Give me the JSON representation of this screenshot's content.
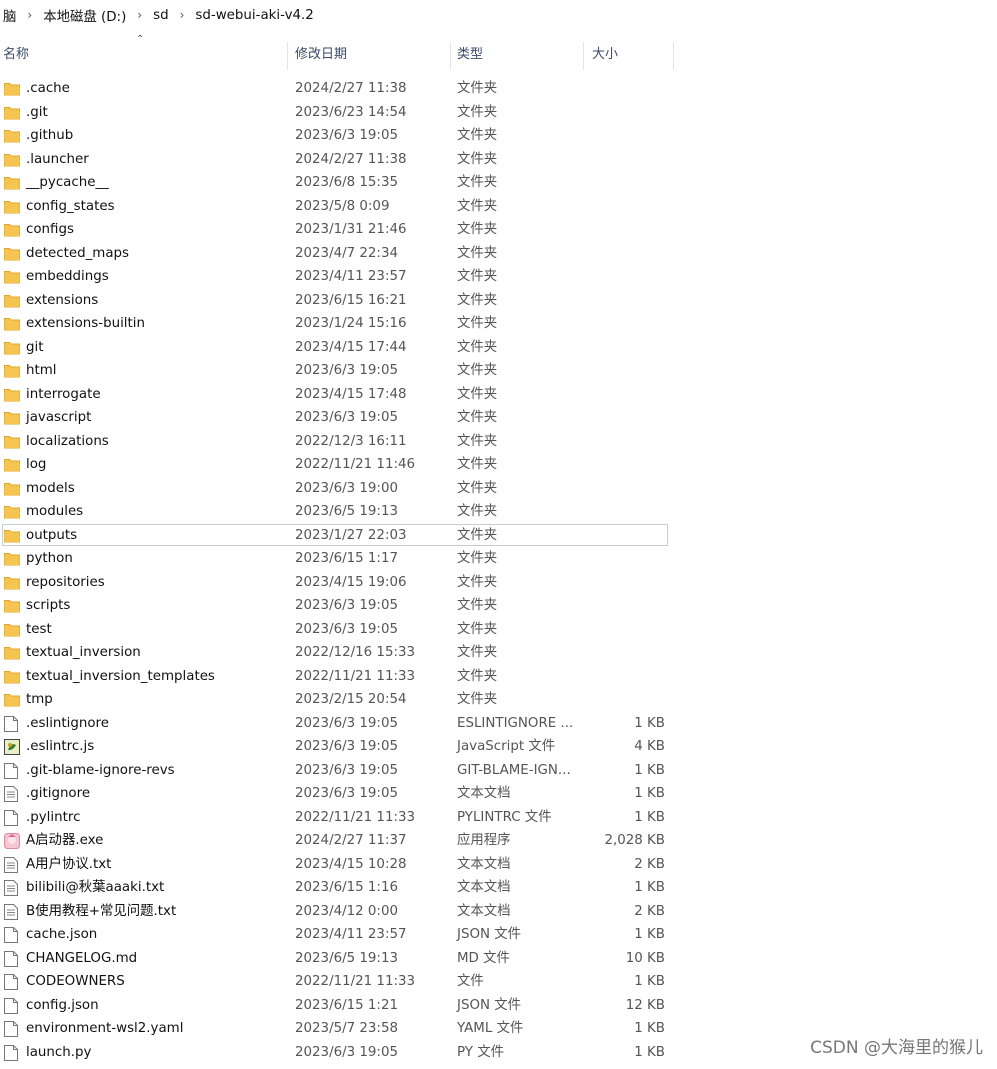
{
  "breadcrumb": [
    "脑",
    "本地磁盘 (D:)",
    "sd",
    "sd-webui-aki-v4.2"
  ],
  "columns": {
    "name": "名称",
    "date": "修改日期",
    "type": "类型",
    "size": "大小"
  },
  "files": [
    {
      "name": ".cache",
      "date": "2024/2/27 11:38",
      "type": "文件夹",
      "size": "",
      "icon": "folder"
    },
    {
      "name": ".git",
      "date": "2023/6/23 14:54",
      "type": "文件夹",
      "size": "",
      "icon": "folder"
    },
    {
      "name": ".github",
      "date": "2023/6/3 19:05",
      "type": "文件夹",
      "size": "",
      "icon": "folder"
    },
    {
      "name": ".launcher",
      "date": "2024/2/27 11:38",
      "type": "文件夹",
      "size": "",
      "icon": "folder"
    },
    {
      "name": "__pycache__",
      "date": "2023/6/8 15:35",
      "type": "文件夹",
      "size": "",
      "icon": "folder"
    },
    {
      "name": "config_states",
      "date": "2023/5/8 0:09",
      "type": "文件夹",
      "size": "",
      "icon": "folder"
    },
    {
      "name": "configs",
      "date": "2023/1/31 21:46",
      "type": "文件夹",
      "size": "",
      "icon": "folder"
    },
    {
      "name": "detected_maps",
      "date": "2023/4/7 22:34",
      "type": "文件夹",
      "size": "",
      "icon": "folder"
    },
    {
      "name": "embeddings",
      "date": "2023/4/11 23:57",
      "type": "文件夹",
      "size": "",
      "icon": "folder"
    },
    {
      "name": "extensions",
      "date": "2023/6/15 16:21",
      "type": "文件夹",
      "size": "",
      "icon": "folder"
    },
    {
      "name": "extensions-builtin",
      "date": "2023/1/24 15:16",
      "type": "文件夹",
      "size": "",
      "icon": "folder"
    },
    {
      "name": "git",
      "date": "2023/4/15 17:44",
      "type": "文件夹",
      "size": "",
      "icon": "folder"
    },
    {
      "name": "html",
      "date": "2023/6/3 19:05",
      "type": "文件夹",
      "size": "",
      "icon": "folder"
    },
    {
      "name": "interrogate",
      "date": "2023/4/15 17:48",
      "type": "文件夹",
      "size": "",
      "icon": "folder"
    },
    {
      "name": "javascript",
      "date": "2023/6/3 19:05",
      "type": "文件夹",
      "size": "",
      "icon": "folder"
    },
    {
      "name": "localizations",
      "date": "2022/12/3 16:11",
      "type": "文件夹",
      "size": "",
      "icon": "folder"
    },
    {
      "name": "log",
      "date": "2022/11/21 11:46",
      "type": "文件夹",
      "size": "",
      "icon": "folder"
    },
    {
      "name": "models",
      "date": "2023/6/3 19:00",
      "type": "文件夹",
      "size": "",
      "icon": "folder"
    },
    {
      "name": "modules",
      "date": "2023/6/5 19:13",
      "type": "文件夹",
      "size": "",
      "icon": "folder"
    },
    {
      "name": "outputs",
      "date": "2023/1/27 22:03",
      "type": "文件夹",
      "size": "",
      "icon": "folder",
      "selected": true
    },
    {
      "name": "python",
      "date": "2023/6/15 1:17",
      "type": "文件夹",
      "size": "",
      "icon": "folder"
    },
    {
      "name": "repositories",
      "date": "2023/4/15 19:06",
      "type": "文件夹",
      "size": "",
      "icon": "folder"
    },
    {
      "name": "scripts",
      "date": "2023/6/3 19:05",
      "type": "文件夹",
      "size": "",
      "icon": "folder"
    },
    {
      "name": "test",
      "date": "2023/6/3 19:05",
      "type": "文件夹",
      "size": "",
      "icon": "folder"
    },
    {
      "name": "textual_inversion",
      "date": "2022/12/16 15:33",
      "type": "文件夹",
      "size": "",
      "icon": "folder"
    },
    {
      "name": "textual_inversion_templates",
      "date": "2022/11/21 11:33",
      "type": "文件夹",
      "size": "",
      "icon": "folder"
    },
    {
      "name": "tmp",
      "date": "2023/2/15 20:54",
      "type": "文件夹",
      "size": "",
      "icon": "folder"
    },
    {
      "name": ".eslintignore",
      "date": "2023/6/3 19:05",
      "type": "ESLINTIGNORE ...",
      "size": "1 KB",
      "icon": "file"
    },
    {
      "name": ".eslintrc.js",
      "date": "2023/6/3 19:05",
      "type": "JavaScript 文件",
      "size": "4 KB",
      "icon": "js"
    },
    {
      "name": ".git-blame-ignore-revs",
      "date": "2023/6/3 19:05",
      "type": "GIT-BLAME-IGN...",
      "size": "1 KB",
      "icon": "file"
    },
    {
      "name": ".gitignore",
      "date": "2023/6/3 19:05",
      "type": "文本文档",
      "size": "1 KB",
      "icon": "text"
    },
    {
      "name": ".pylintrc",
      "date": "2022/11/21 11:33",
      "type": "PYLINTRC 文件",
      "size": "1 KB",
      "icon": "file"
    },
    {
      "name": "A启动器.exe",
      "date": "2024/2/27 11:37",
      "type": "应用程序",
      "size": "2,028 KB",
      "icon": "exe"
    },
    {
      "name": "A用户协议.txt",
      "date": "2023/4/15 10:28",
      "type": "文本文档",
      "size": "2 KB",
      "icon": "text"
    },
    {
      "name": "bilibili@秋葉aaaki.txt",
      "date": "2023/6/15 1:16",
      "type": "文本文档",
      "size": "1 KB",
      "icon": "text"
    },
    {
      "name": "B使用教程+常见问题.txt",
      "date": "2023/4/12 0:00",
      "type": "文本文档",
      "size": "2 KB",
      "icon": "text"
    },
    {
      "name": "cache.json",
      "date": "2023/4/11 23:57",
      "type": "JSON 文件",
      "size": "1 KB",
      "icon": "file"
    },
    {
      "name": "CHANGELOG.md",
      "date": "2023/6/5 19:13",
      "type": "MD 文件",
      "size": "10 KB",
      "icon": "file"
    },
    {
      "name": "CODEOWNERS",
      "date": "2022/11/21 11:33",
      "type": "文件",
      "size": "1 KB",
      "icon": "file"
    },
    {
      "name": "config.json",
      "date": "2023/6/15 1:21",
      "type": "JSON 文件",
      "size": "12 KB",
      "icon": "file"
    },
    {
      "name": "environment-wsl2.yaml",
      "date": "2023/5/7 23:58",
      "type": "YAML 文件",
      "size": "1 KB",
      "icon": "file"
    },
    {
      "name": "launch.py",
      "date": "2023/6/3 19:05",
      "type": "PY 文件",
      "size": "1 KB",
      "icon": "file"
    }
  ],
  "watermark": "CSDN @大海里的猴儿",
  "colors": {
    "folder": "#f5c451",
    "folder_dark": "#e0a92e",
    "selection_border": "#c8cdd4"
  }
}
